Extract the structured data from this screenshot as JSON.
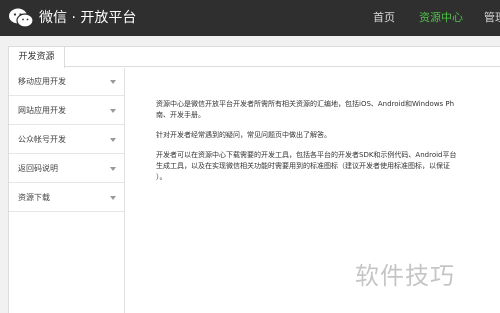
{
  "header": {
    "brand": "微信 · 开放平台",
    "nav": [
      {
        "label": "首页",
        "active": false
      },
      {
        "label": "资源中心",
        "active": true
      },
      {
        "label": "管理",
        "active": false
      }
    ],
    "active_color": "#4fc14a"
  },
  "tab": {
    "label": "开发资源"
  },
  "sidebar": {
    "items": [
      {
        "label": "移动应用开发"
      },
      {
        "label": "网站应用开发"
      },
      {
        "label": "公众帐号开发"
      },
      {
        "label": "返回码说明"
      },
      {
        "label": "资源下载"
      }
    ]
  },
  "content": {
    "p1_line1": "资源中心是微信开放平台开发者所需所有相关资源的汇编地，包括iOS、Android和Windows Ph",
    "p1_line2": "南、开发手册。",
    "p2": "针对开发者经常遇到的疑问，常见问题页中做出了解答。",
    "p3_line1": "开发者可以在资源中心下载需要的开发工具，包括各平台的开发者SDK和示例代码、Android平台",
    "p3_line2": "生成工具，以及在实现微信相关功能时需要用到的标准图标（建议开发者使用标准图标，以保证",
    "p3_line3": "）。"
  },
  "watermark": "软件技巧"
}
